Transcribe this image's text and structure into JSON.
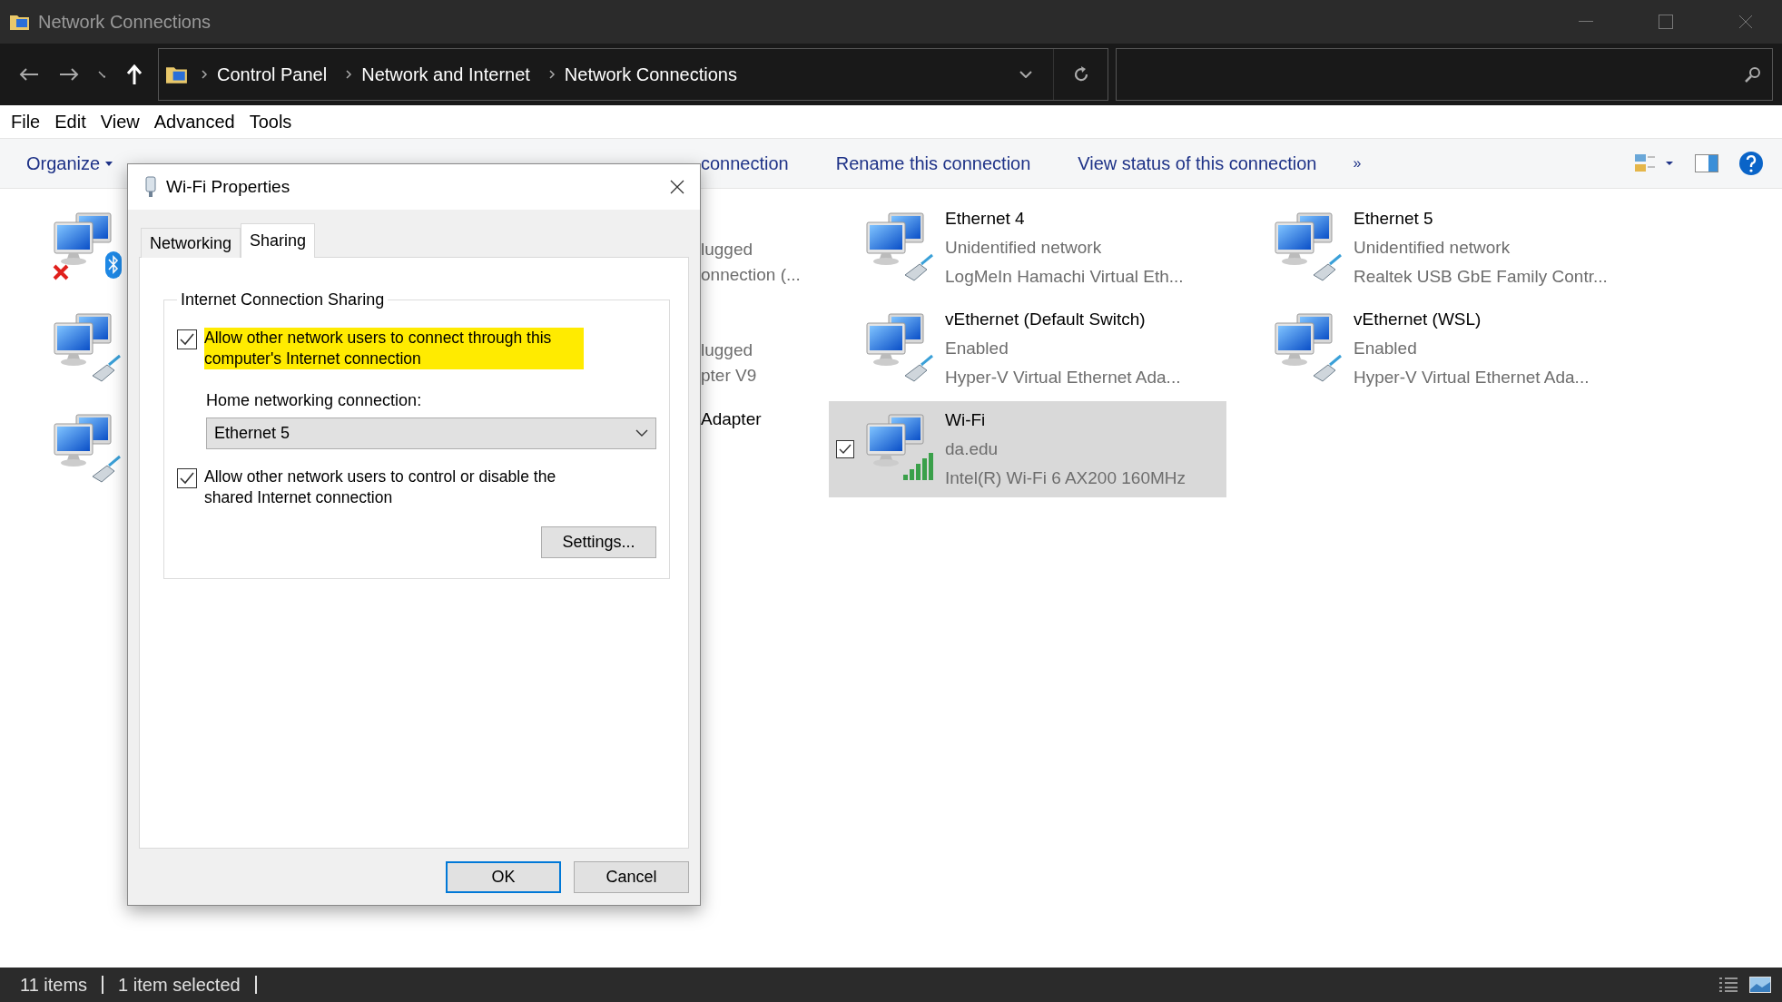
{
  "window": {
    "title": "Network Connections"
  },
  "address_bar": {
    "breadcrumbs": [
      "Control Panel",
      "Network and Internet",
      "Network Connections"
    ]
  },
  "menu": [
    "File",
    "Edit",
    "View",
    "Advanced",
    "Tools"
  ],
  "toolbar": [
    {
      "label": "Organize",
      "kind": "dropdown"
    },
    {
      "label": "connection",
      "kind": "action"
    },
    {
      "label": "Rename this connection",
      "kind": "action"
    },
    {
      "label": "View status of this connection",
      "kind": "action"
    },
    {
      "label": "»",
      "kind": "more"
    }
  ],
  "connections": [
    {
      "kind": "bluetooth",
      "selected": false
    },
    {
      "kind": "partial",
      "status": "lugged",
      "device": "onnection (...",
      "selected": false
    },
    {
      "kind": "cable",
      "name": "Ethernet 4",
      "status": "Unidentified network",
      "device": "LogMeIn Hamachi Virtual Eth...",
      "selected": false
    },
    {
      "kind": "cable",
      "name": "Ethernet 5",
      "status": "Unidentified network",
      "device": "Realtek USB GbE Family Contr...",
      "selected": false
    },
    {
      "kind": "cable",
      "selected": false
    },
    {
      "kind": "partial",
      "status": "lugged",
      "device": "pter V9",
      "selected": false
    },
    {
      "kind": "cable",
      "name": "vEthernet (Default Switch)",
      "status": "Enabled",
      "device": "Hyper-V Virtual Ethernet Ada...",
      "selected": false
    },
    {
      "kind": "cable",
      "name": "vEthernet (WSL)",
      "status": "Enabled",
      "device": "Hyper-V Virtual Ethernet Ada...",
      "selected": false
    },
    {
      "kind": "cable",
      "selected": false
    },
    {
      "kind": "partial",
      "name": "Adapter",
      "selected": false
    },
    {
      "kind": "wifi",
      "name": "Wi-Fi",
      "status": "da.edu",
      "device": "Intel(R) Wi-Fi 6 AX200 160MHz",
      "selected": true
    }
  ],
  "status_bar": {
    "count": "11 items",
    "selection": "1 item selected"
  },
  "dialog": {
    "title": "Wi-Fi Properties",
    "tabs": [
      {
        "label": "Networking",
        "selected": false
      },
      {
        "label": "Sharing",
        "selected": true
      }
    ],
    "group_title": "Internet Connection Sharing",
    "options": [
      {
        "label": "Allow other network users to connect through this computer's Internet connection",
        "checked": true,
        "highlighted": true
      },
      {
        "label": "Allow other network users to control or disable the shared Internet connection",
        "checked": true,
        "highlighted": false
      }
    ],
    "home_connection": {
      "label": "Home networking connection:",
      "value": "Ethernet 5"
    },
    "settings_button": "Settings...",
    "buttons": [
      {
        "label": "OK",
        "default": true
      },
      {
        "label": "Cancel",
        "default": false
      }
    ]
  }
}
